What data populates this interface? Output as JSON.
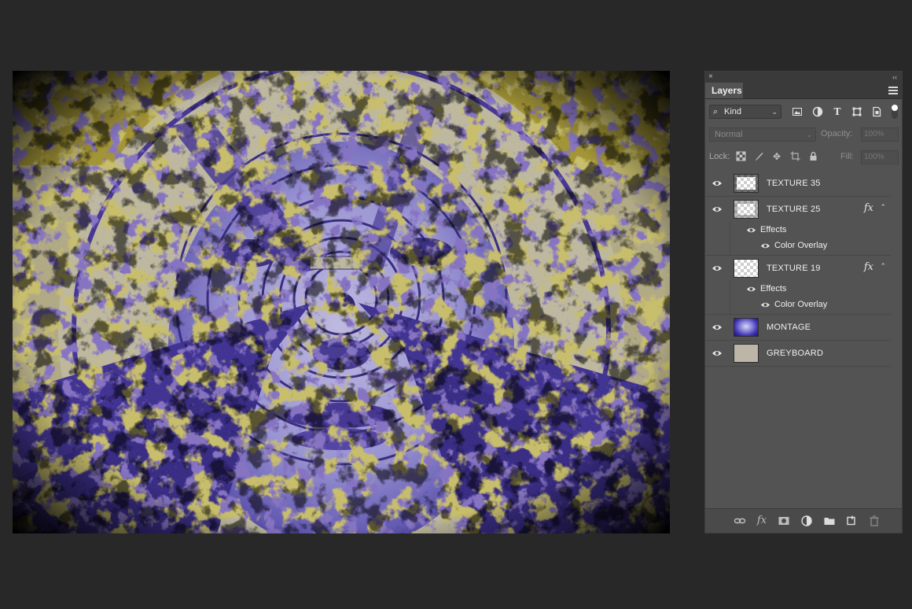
{
  "canvas": {
    "image_description_icon": "collage-artwork"
  },
  "panel": {
    "close_glyph": "×",
    "collapse_glyph": "‹‹",
    "tab_label": "Layers",
    "filter": {
      "kind_label": "Kind",
      "search_glyph": "⌕",
      "icons": [
        "image-filter-icon",
        "adjustment-filter-icon",
        "type-filter-icon",
        "shape-filter-icon",
        "smart-object-filter-icon"
      ]
    },
    "blend": {
      "mode": "Normal",
      "opacity_label": "Opacity:",
      "opacity_value": "100%"
    },
    "lock": {
      "label": "Lock:",
      "fill_label": "Fill:",
      "fill_value": "100%"
    },
    "layers": [
      {
        "name": "TEXTURE 35",
        "visible": true,
        "thumb": "transparent-texture",
        "fx": false
      },
      {
        "name": "TEXTURE 25",
        "visible": true,
        "thumb": "transparent-texture",
        "fx": true,
        "effects_label": "Effects",
        "effect": "Color Overlay"
      },
      {
        "name": "TEXTURE 19",
        "visible": true,
        "thumb": "transparent",
        "fx": true,
        "effects_label": "Effects",
        "effect": "Color Overlay"
      },
      {
        "name": "MONTAGE",
        "visible": true,
        "thumb": "blue-portrait"
      },
      {
        "name": "GREYBOARD",
        "visible": true,
        "thumb": "grey-fill"
      }
    ],
    "fx_label": "fx",
    "bottom_icons": [
      "link-layers-icon",
      "add-style-icon",
      "add-mask-icon",
      "adjustment-layer-icon",
      "new-group-icon",
      "new-layer-icon",
      "delete-layer-icon"
    ]
  },
  "colors": {
    "workspace": "#282828",
    "panel": "#535353",
    "art_yellow": "#a89a1c",
    "art_purple": "#3b2b8c",
    "art_lavender": "#8d89d6"
  }
}
